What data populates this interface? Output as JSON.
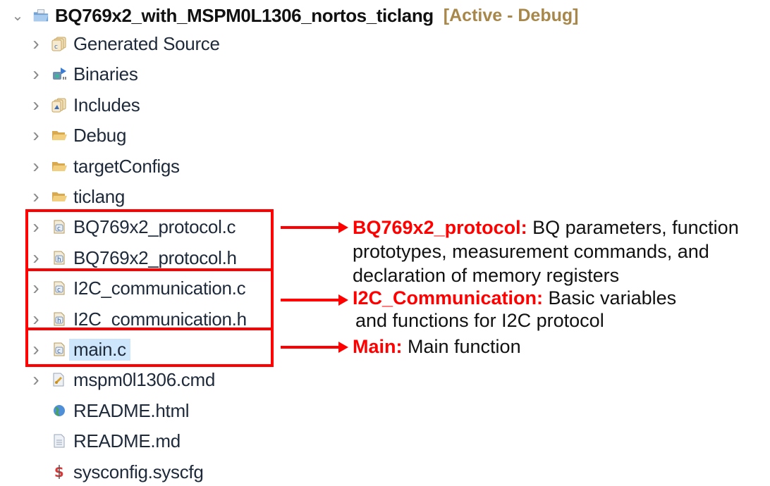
{
  "project": {
    "name": "BQ769x2_with_MSPM0L1306_nortos_ticlang",
    "tag": "[Active - Debug]",
    "expanded": true
  },
  "items": [
    {
      "label": "Generated Source",
      "icon": "generated-source-icon",
      "expandable": true
    },
    {
      "label": "Binaries",
      "icon": "binaries-icon",
      "expandable": true
    },
    {
      "label": "Includes",
      "icon": "includes-icon",
      "expandable": true
    },
    {
      "label": "Debug",
      "icon": "folder-icon",
      "expandable": true
    },
    {
      "label": "targetConfigs",
      "icon": "folder-icon",
      "expandable": true
    },
    {
      "label": "ticlang",
      "icon": "folder-icon",
      "expandable": true
    },
    {
      "label": "BQ769x2_protocol.c",
      "icon": "c-file-icon",
      "expandable": true
    },
    {
      "label": "BQ769x2_protocol.h",
      "icon": "h-file-icon",
      "expandable": true
    },
    {
      "label": "I2C_communication.c",
      "icon": "c-file-icon",
      "expandable": true
    },
    {
      "label": "I2C_communication.h",
      "icon": "h-file-icon",
      "expandable": true
    },
    {
      "label": "main.c",
      "icon": "c-file-icon",
      "expandable": true,
      "selected": true
    },
    {
      "label": "mspm0l1306.cmd",
      "icon": "linker-cmd-icon",
      "expandable": true
    },
    {
      "label": "README.html",
      "icon": "globe-icon",
      "expandable": false
    },
    {
      "label": "README.md",
      "icon": "text-file-icon",
      "expandable": false
    },
    {
      "label": "sysconfig.syscfg",
      "icon": "sysconfig-icon",
      "expandable": false
    }
  ],
  "annotations": [
    {
      "key": "BQ769x2_protocol:",
      "text": " BQ parameters, function",
      "lines": [
        "prototypes, measurement commands, and",
        "declaration of memory registers"
      ]
    },
    {
      "key": "I2C_Communication:",
      "text": " Basic variables",
      "lines": [
        "and functions for I2C protocol"
      ]
    },
    {
      "key": "Main:",
      "text": " Main function",
      "lines": []
    }
  ],
  "colors": {
    "annotation_red": "#ff0000",
    "active_tag": "#a8884a",
    "selection": "#cde6fb"
  }
}
